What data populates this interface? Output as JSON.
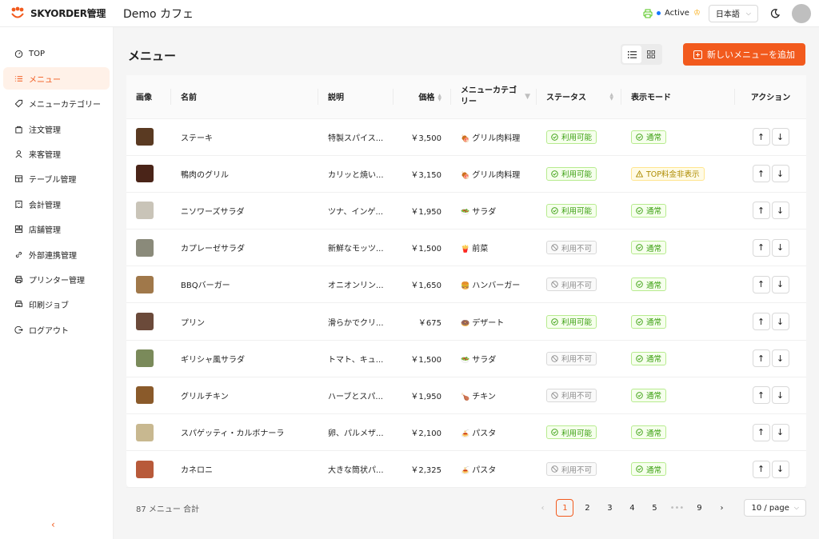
{
  "brand": {
    "name": "SKYORDER管理",
    "accent": "#f25a1d"
  },
  "header": {
    "shop_name": "Demo カフェ",
    "status": "Active",
    "language": "日本語"
  },
  "sidebar": {
    "items": [
      {
        "label": "TOP",
        "icon": "dashboard-icon",
        "active": false
      },
      {
        "label": "メニュー",
        "icon": "list-icon",
        "active": true
      },
      {
        "label": "メニューカテゴリー",
        "icon": "tag-icon",
        "active": false
      },
      {
        "label": "注文管理",
        "icon": "bag-icon",
        "active": false
      },
      {
        "label": "来客管理",
        "icon": "user-icon",
        "active": false
      },
      {
        "label": "テーブル管理",
        "icon": "table-icon",
        "active": false
      },
      {
        "label": "会計管理",
        "icon": "receipt-icon",
        "active": false
      },
      {
        "label": "店舗管理",
        "icon": "store-icon",
        "active": false
      },
      {
        "label": "外部連携管理",
        "icon": "link-icon",
        "active": false
      },
      {
        "label": "プリンター管理",
        "icon": "printer-icon",
        "active": false
      },
      {
        "label": "印刷ジョブ",
        "icon": "print-job-icon",
        "active": false
      },
      {
        "label": "ログアウト",
        "icon": "logout-icon",
        "active": false
      }
    ],
    "collapse_label": "‹"
  },
  "main": {
    "title": "メニュー",
    "add_button": "新しいメニューを追加",
    "columns": {
      "image": "画像",
      "name": "名前",
      "description": "説明",
      "price": "価格",
      "category": "メニューカテゴリー",
      "status": "ステータス",
      "display_mode": "表示モード",
      "action": "アクション"
    },
    "rows": [
      {
        "name": "ステーキ",
        "description": "特製スパイス...",
        "price": "￥3,500",
        "category": "グリル肉料理",
        "cat_icon": "🍖",
        "status": "利用可能",
        "status_ok": true,
        "display": "通常",
        "display_ok": true,
        "thumb": "#5a3a22"
      },
      {
        "name": "鴨肉のグリル",
        "description": "カリッと焼い...",
        "price": "￥3,150",
        "category": "グリル肉料理",
        "cat_icon": "🍖",
        "status": "利用可能",
        "status_ok": true,
        "display": "TOP料金非表示",
        "display_ok": false,
        "thumb": "#4a2418"
      },
      {
        "name": "ニソワーズサラダ",
        "description": "ツナ、インゲ...",
        "price": "￥1,950",
        "category": "サラダ",
        "cat_icon": "🥗",
        "status": "利用可能",
        "status_ok": true,
        "display": "通常",
        "display_ok": true,
        "thumb": "#c9c4b8"
      },
      {
        "name": "カプレーゼサラダ",
        "description": "新鮮なモッツ...",
        "price": "￥1,500",
        "category": "前菜",
        "cat_icon": "🍟",
        "status": "利用不可",
        "status_ok": false,
        "display": "通常",
        "display_ok": true,
        "thumb": "#8a8a7a"
      },
      {
        "name": "BBQバーガー",
        "description": "オニオンリン...",
        "price": "￥1,650",
        "category": "ハンバーガー",
        "cat_icon": "🍔",
        "status": "利用不可",
        "status_ok": false,
        "display": "通常",
        "display_ok": true,
        "thumb": "#a0784a"
      },
      {
        "name": "プリン",
        "description": "滑らかでクリ...",
        "price": "￥675",
        "category": "デザート",
        "cat_icon": "🍩",
        "status": "利用可能",
        "status_ok": true,
        "display": "通常",
        "display_ok": true,
        "thumb": "#6b4a3a"
      },
      {
        "name": "ギリシャ風サラダ",
        "description": "トマト、キュ...",
        "price": "￥1,500",
        "category": "サラダ",
        "cat_icon": "🥗",
        "status": "利用不可",
        "status_ok": false,
        "display": "通常",
        "display_ok": true,
        "thumb": "#7a8a5a"
      },
      {
        "name": "グリルチキン",
        "description": "ハーブとスパ...",
        "price": "￥1,950",
        "category": "チキン",
        "cat_icon": "🍗",
        "status": "利用不可",
        "status_ok": false,
        "display": "通常",
        "display_ok": true,
        "thumb": "#8a5a2a"
      },
      {
        "name": "スパゲッティ・カルボナーラ",
        "description": "卵、パルメザ...",
        "price": "￥2,100",
        "category": "パスタ",
        "cat_icon": "🍝",
        "status": "利用可能",
        "status_ok": true,
        "display": "通常",
        "display_ok": true,
        "thumb": "#c8b890"
      },
      {
        "name": "カネロニ",
        "description": "大きな筒状パ...",
        "price": "￥2,325",
        "category": "パスタ",
        "cat_icon": "🍝",
        "status": "利用不可",
        "status_ok": false,
        "display": "通常",
        "display_ok": true,
        "thumb": "#b85a3a"
      }
    ],
    "total_text": "87 メニュー 合計",
    "pagination": {
      "prev": "‹",
      "pages": [
        "1",
        "2",
        "3",
        "4",
        "5"
      ],
      "ellipsis": "•••",
      "last": "9",
      "next": "›",
      "current": "1",
      "page_size": "10 / page"
    }
  }
}
